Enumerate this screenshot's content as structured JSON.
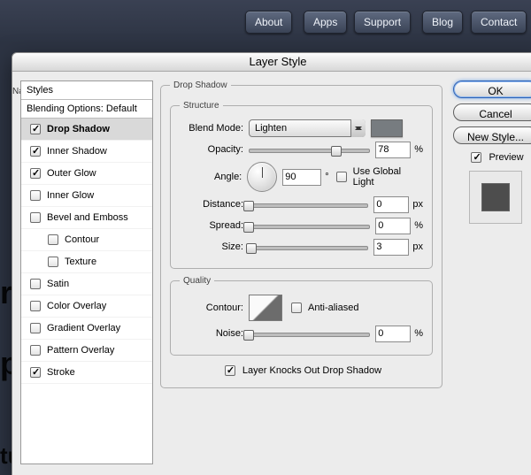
{
  "nav": {
    "about": "About",
    "apps": "Apps",
    "support": "Support",
    "blog": "Blog",
    "contact": "Contact"
  },
  "dialog": {
    "title": "Layer Style",
    "left_nav_label": "Na",
    "styles": {
      "header": "Styles",
      "blending_header": "Blending Options: Default",
      "items": [
        {
          "label": "Drop Shadow",
          "checked": true,
          "selected": true
        },
        {
          "label": "Inner Shadow",
          "checked": true
        },
        {
          "label": "Outer Glow",
          "checked": true
        },
        {
          "label": "Inner Glow",
          "checked": false
        },
        {
          "label": "Bevel and Emboss",
          "checked": false
        },
        {
          "label": "Contour",
          "checked": false,
          "indent": true
        },
        {
          "label": "Texture",
          "checked": false,
          "indent": true
        },
        {
          "label": "Satin",
          "checked": false
        },
        {
          "label": "Color Overlay",
          "checked": false
        },
        {
          "label": "Gradient Overlay",
          "checked": false
        },
        {
          "label": "Pattern Overlay",
          "checked": false
        },
        {
          "label": "Stroke",
          "checked": true
        }
      ]
    },
    "drop_shadow": {
      "legend": "Drop Shadow",
      "structure_legend": "Structure",
      "blend_mode": {
        "label": "Blend Mode:",
        "value": "Lighten"
      },
      "swatch_color": "#777c80",
      "opacity": {
        "label": "Opacity:",
        "value": "78",
        "unit": "%",
        "pos": 72
      },
      "angle": {
        "label": "Angle:",
        "value": "90",
        "unit": "°",
        "use_global_label": "Use Global Light",
        "use_global": false
      },
      "distance": {
        "label": "Distance:",
        "value": "0",
        "unit": "px",
        "pos": 0
      },
      "spread": {
        "label": "Spread:",
        "value": "0",
        "unit": "%",
        "pos": 0
      },
      "size": {
        "label": "Size:",
        "value": "3",
        "unit": "px",
        "pos": 2
      },
      "quality_legend": "Quality",
      "contour": {
        "label": "Contour:",
        "anti_label": "Anti-aliased",
        "anti": false
      },
      "noise": {
        "label": "Noise:",
        "value": "0",
        "unit": "%",
        "pos": 0
      },
      "knock": {
        "label": "Layer Knocks Out Drop Shadow",
        "checked": true
      }
    },
    "buttons": {
      "ok": "OK",
      "cancel": "Cancel",
      "new_style": "New Style...",
      "preview_label": "Preview",
      "preview_checked": true
    }
  },
  "bg_text": {
    "a": "re",
    "b": "p",
    "c": "tures"
  }
}
